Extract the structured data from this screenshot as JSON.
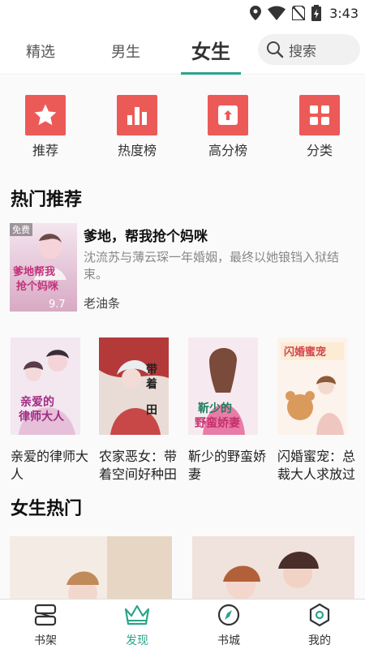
{
  "status_bar": {
    "time": "3:43",
    "icons": [
      "location-icon",
      "wifi-icon",
      "no-sim-icon",
      "battery-charging-icon"
    ]
  },
  "top_tabs": [
    {
      "label": "精选",
      "active": false
    },
    {
      "label": "男生",
      "active": false
    },
    {
      "label": "女生",
      "active": true
    }
  ],
  "search": {
    "label": "搜索",
    "icon": "search-icon"
  },
  "quick_links": [
    {
      "label": "推荐",
      "icon": "star-icon"
    },
    {
      "label": "热度榜",
      "icon": "bar-chart-icon"
    },
    {
      "label": "高分榜",
      "icon": "arrow-up-icon"
    },
    {
      "label": "分类",
      "icon": "grid-icon"
    }
  ],
  "hot_recommend": {
    "title": "热门推荐",
    "featured": {
      "title": "爹地，帮我抢个妈咪",
      "description": "沈流苏与薄云琛一年婚姻，最终以她锒铛入狱结束。",
      "author": "老油条",
      "badge": "免费",
      "cover_title": "爹地帮我抢个妈咪",
      "score": "9.7"
    },
    "books": [
      {
        "title": "亲爱的律师大人",
        "cover_title": "亲爱的律师大人"
      },
      {
        "title": "农家恶女：带着空间好种田",
        "cover_title": "带着空间好种田"
      },
      {
        "title": "靳少的野蛮娇妻",
        "cover_title": "靳少的野蛮娇妻"
      },
      {
        "title": "闪婚蜜宠：总裁大人求放过",
        "cover_title": "闪婚蜜宠"
      }
    ]
  },
  "female_hot": {
    "title": "女生热门"
  },
  "bottom_tabs": [
    {
      "label": "书架",
      "icon": "bookshelf-icon",
      "active": false
    },
    {
      "label": "发现",
      "icon": "crown-icon",
      "active": true
    },
    {
      "label": "书城",
      "icon": "compass-icon",
      "active": false
    },
    {
      "label": "我的",
      "icon": "hexagon-icon",
      "active": false
    }
  ],
  "colors": {
    "accent": "#2aa58b",
    "quick_icon_bg": "#ec5a58",
    "divider": "#eeeeee"
  }
}
